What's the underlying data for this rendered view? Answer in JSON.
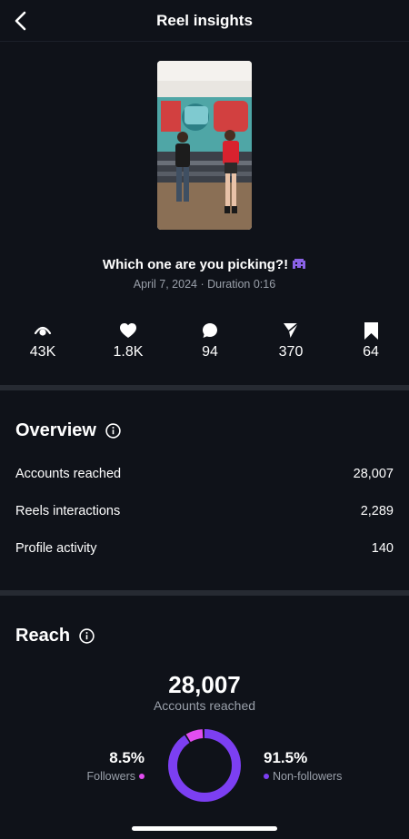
{
  "header": {
    "title": "Reel insights",
    "back_icon": "chevron-left-icon"
  },
  "reel": {
    "title": "Which one are you picking?!",
    "emoji_icon": "alien-monster-icon",
    "date": "April 7, 2024",
    "separator": "·",
    "duration": "Duration 0:16"
  },
  "stats": [
    {
      "icon": "eye-icon",
      "value": "43K"
    },
    {
      "icon": "heart-icon",
      "value": "1.8K"
    },
    {
      "icon": "comment-icon",
      "value": "94"
    },
    {
      "icon": "send-icon",
      "value": "370"
    },
    {
      "icon": "bookmark-icon",
      "value": "64"
    }
  ],
  "overview": {
    "title": "Overview",
    "rows": [
      {
        "label": "Accounts reached",
        "value": "28,007"
      },
      {
        "label": "Reels interactions",
        "value": "2,289"
      },
      {
        "label": "Profile activity",
        "value": "140"
      }
    ]
  },
  "reach": {
    "title": "Reach",
    "total": "28,007",
    "total_label": "Accounts reached",
    "followers": {
      "percent": "8.5%",
      "label": "Followers",
      "fraction": 0.085,
      "color": "#e24df0"
    },
    "non_followers": {
      "percent": "91.5%",
      "label": "Non-followers",
      "fraction": 0.915,
      "color": "#7c3ff2"
    }
  },
  "colors": {
    "background": "#0f1219",
    "divider": "#262a32",
    "secondary_text": "#9aa0aa"
  }
}
